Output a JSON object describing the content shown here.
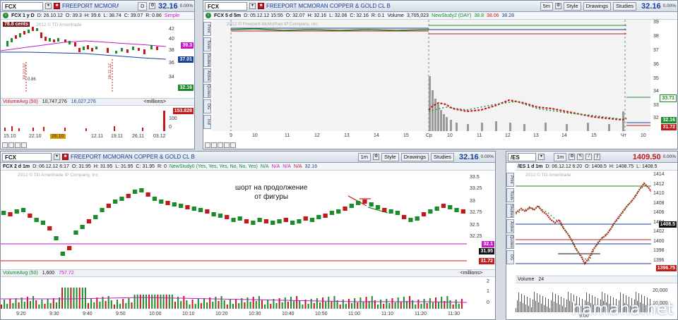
{
  "p1": {
    "symbol": "FCX",
    "desc": "FREEPORT MCMORAN",
    "period": "D",
    "price": "32.16",
    "pct": "0.00%",
    "info": [
      "FCX 1 y D",
      "D: 26.10.12",
      "O: 39.3",
      "H: 39.6",
      "L: 38.74",
      "C: 39.07",
      "R: 0.86",
      "Simple"
    ],
    "badge": "78.8 cents",
    "watermark": "2012 © TD Ameritrade",
    "yticks": [
      "42",
      "40",
      "38",
      "36",
      "34",
      "32"
    ],
    "tags": {
      "a": "39.3",
      "b": "37.01",
      "c": "32.16"
    },
    "vert_dates": [
      "19.10.12",
      "16.11.12",
      "19.10.12"
    ],
    "small": "0.86",
    "vol_label": "VolumeAvg (50)",
    "vol1": "10,747,276",
    "vol2": "16,027,276",
    "vol_units": "<millions>",
    "vol_tag": "153.828",
    "vol_ticks": [
      "100",
      "0"
    ],
    "xlabels": [
      "15.10",
      "22.10",
      "26.10",
      "12.11",
      "19.11",
      "26.11",
      "03.12"
    ]
  },
  "p2": {
    "symbol": "FCX",
    "desc": "FREEPORT MCMORAN COPPER & GOLD CL B",
    "period": "5m",
    "style": "Style",
    "drawings": "Drawings",
    "studies": "Studies",
    "price": "32.16",
    "pct": "0.00%",
    "info": [
      "FCX 5 d 5m",
      "D: 05.12.12 15:55",
      "O: 32.07",
      "H: 32.16",
      "L: 32.06",
      "C: 32.16",
      "R: 0.1",
      "Volume",
      "3,705,023",
      "NewStudy2 (DAY)",
      "38.8",
      "38.06",
      "38.28"
    ],
    "watermark": "2012 © Freeport-McMoRan IP Company, Inc.",
    "yticks": [
      "39",
      "38",
      "37",
      "36",
      "35",
      "34",
      "33",
      "32"
    ],
    "tags": {
      "a": "33.71",
      "b": "32.16",
      "c": "31.72"
    },
    "vtabs": [
      "Print",
      "Tools",
      "Studies",
      "Active",
      "Quotes",
      "DG",
      "Ind"
    ],
    "xlabels": [
      "9",
      "10",
      "11",
      "12",
      "13",
      "14",
      "15",
      "Ср",
      "10",
      "11",
      "12",
      "13",
      "14",
      "15",
      "Чт",
      "10"
    ]
  },
  "p3": {
    "symbol": "FCX",
    "desc": "FREEPORT MCMORAN COPPER & GOLD CL B",
    "period": "1m",
    "style": "Style",
    "drawings": "Drawings",
    "studies": "Studies",
    "price": "32.16",
    "pct": "0.00%",
    "info": [
      "FCX 2 d 1m",
      "D: 06.12.12 6:17",
      "O: 31.95",
      "H: 31.95",
      "L: 31.95",
      "C: 31.95",
      "R: 0",
      "NewStudy0 (Yes, Yes, Yes, No, No, Yes)",
      "N/A",
      "N/A",
      "N/A",
      "N/A",
      "32.16"
    ],
    "watermark": "2012 © TD Ameritrade IP Company, Inc.",
    "annotation": "шорт на продолжение\nот фигуры",
    "yticks": [
      "33.5",
      "33.25",
      "33",
      "32.75",
      "32.5",
      "32.25",
      "32",
      "31.75"
    ],
    "tags": {
      "a": "32.1",
      "b": "31.95",
      "c": "31.72"
    },
    "vol_label": "VolumeAvg (50)",
    "vol1": "1,600",
    "vol2": "757.72",
    "vol_units": "<millions>",
    "vol_ticks": [
      "2",
      "1",
      "0"
    ],
    "xlabels": [
      "9:20",
      "9:30",
      "9:40",
      "9:50",
      "10:00",
      "10:10",
      "10:20",
      "10:30",
      "10:40",
      "10:50",
      "11:00",
      "11:10",
      "11:20",
      "11:30"
    ]
  },
  "p4": {
    "symbol": "/ES",
    "period": "1m",
    "price": "1409.50",
    "pct": "0.00%",
    "info": [
      "/ES 1 d 1m",
      "D: 06.12.12 6:20",
      "O: 1408.5",
      "H: 1408.75",
      "L: 1408.5"
    ],
    "watermark": "2012 © TD Ameritrade",
    "yticks": [
      "1414",
      "1412",
      "1410",
      "1408",
      "1406",
      "1404",
      "1402",
      "1400",
      "1398",
      "1396"
    ],
    "tags": {
      "a": "1408.5",
      "b": "1396.75"
    },
    "vtabs": [
      "Print",
      "Tools",
      "Studies",
      "Active",
      "Quotes",
      "DG"
    ],
    "vol_label": "Volume",
    "vol1": "24",
    "vol_ticks": [
      "20,000",
      "10,000"
    ],
    "xlabels": [
      "9:00"
    ]
  },
  "site": "hamaha.net",
  "colors": {
    "up": "#1b8c2a",
    "down": "#c41919",
    "accent": "#1a3f9a"
  }
}
